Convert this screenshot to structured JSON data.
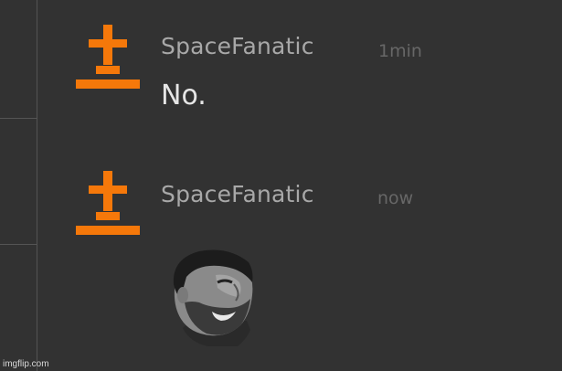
{
  "messages": [
    {
      "username": "SpaceFanatic",
      "timestamp": "1min",
      "text": "No."
    },
    {
      "username": "SpaceFanatic",
      "timestamp": "now",
      "text": ""
    }
  ],
  "colors": {
    "background": "#323232",
    "avatar": "#f5780a",
    "username": "#a8a8a8",
    "timestamp": "#676767",
    "message_text": "#e6e6e6",
    "divider": "#545454"
  },
  "icons": {
    "avatar": "space-rocket-avatar-icon",
    "emote": "chad-face-emote"
  },
  "watermark": "imgflip.com"
}
